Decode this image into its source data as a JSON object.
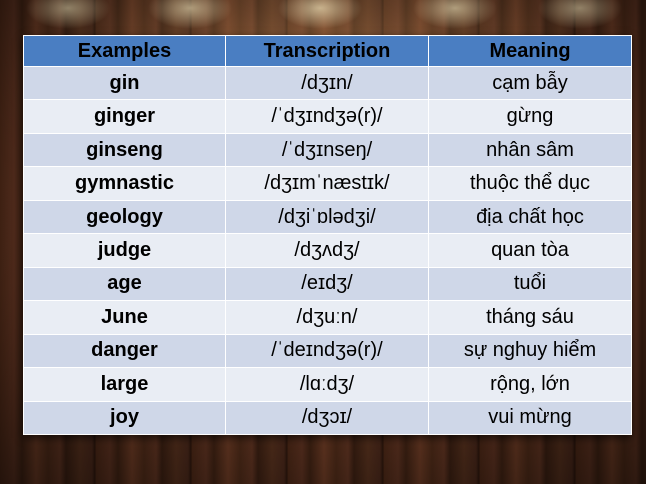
{
  "table": {
    "headers": [
      "Examples",
      "Transcription",
      "Meaning"
    ],
    "rows": [
      [
        "gin",
        "/dʒɪn/",
        "cạm bẫy"
      ],
      [
        "ginger",
        "/ˈdʒɪndʒə(r)/",
        "gừng"
      ],
      [
        "ginseng",
        "/ˈdʒɪnseŋ/",
        "nhân sâm"
      ],
      [
        "gymnastic",
        "/dʒɪmˈnæstɪk/",
        "thuộc thể dục"
      ],
      [
        "geology",
        "/dʒiˈɒlədʒi/",
        "địa chất học"
      ],
      [
        "judge",
        "/dʒʌdʒ/",
        "quan tòa"
      ],
      [
        "age",
        "/eɪdʒ/",
        "tuổi"
      ],
      [
        "June",
        "/dʒuːn/",
        "tháng sáu"
      ],
      [
        "danger",
        "/ˈdeɪndʒə(r)/",
        "sự nghuy hiểm"
      ],
      [
        "large",
        "/lɑːdʒ/",
        "rộng, lớn"
      ],
      [
        "joy",
        "/dʒɔɪ/",
        "vui mừng"
      ]
    ]
  },
  "colors": {
    "header_bg": "#4a7ec2",
    "row_odd_bg": "#cfd7e8",
    "row_even_bg": "#e9edf4",
    "background": "wood-brown"
  }
}
